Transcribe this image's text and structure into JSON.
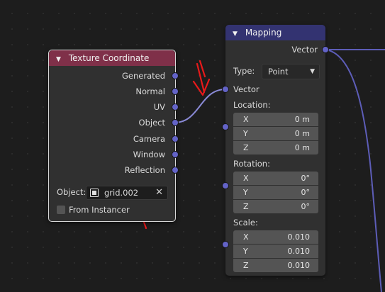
{
  "colors": {
    "texcoord_header": "#7f3049",
    "mapping_header": "#333371",
    "socket": "#6363c7",
    "wire": "#5d5db8",
    "annotation": "#e8191a"
  },
  "texcoord": {
    "title": "Texture Coordinate",
    "outputs": [
      "Generated",
      "Normal",
      "UV",
      "Object",
      "Camera",
      "Window",
      "Reflection"
    ],
    "object_label": "Object:",
    "object_value": "grid.002",
    "from_instancer": "From Instancer"
  },
  "mapping": {
    "title": "Mapping",
    "output": "Vector",
    "type_label": "Type:",
    "type_value": "Point",
    "input_vector": "Vector",
    "location": {
      "label": "Location:",
      "rows": [
        {
          "axis": "X",
          "value": "0 m"
        },
        {
          "axis": "Y",
          "value": "0 m"
        },
        {
          "axis": "Z",
          "value": "0 m"
        }
      ]
    },
    "rotation": {
      "label": "Rotation:",
      "rows": [
        {
          "axis": "X",
          "value": "0°"
        },
        {
          "axis": "Y",
          "value": "0°"
        },
        {
          "axis": "Z",
          "value": "0°"
        }
      ]
    },
    "scale": {
      "label": "Scale:",
      "rows": [
        {
          "axis": "X",
          "value": "0.010"
        },
        {
          "axis": "Y",
          "value": "0.010"
        },
        {
          "axis": "Z",
          "value": "0.010"
        }
      ]
    }
  }
}
